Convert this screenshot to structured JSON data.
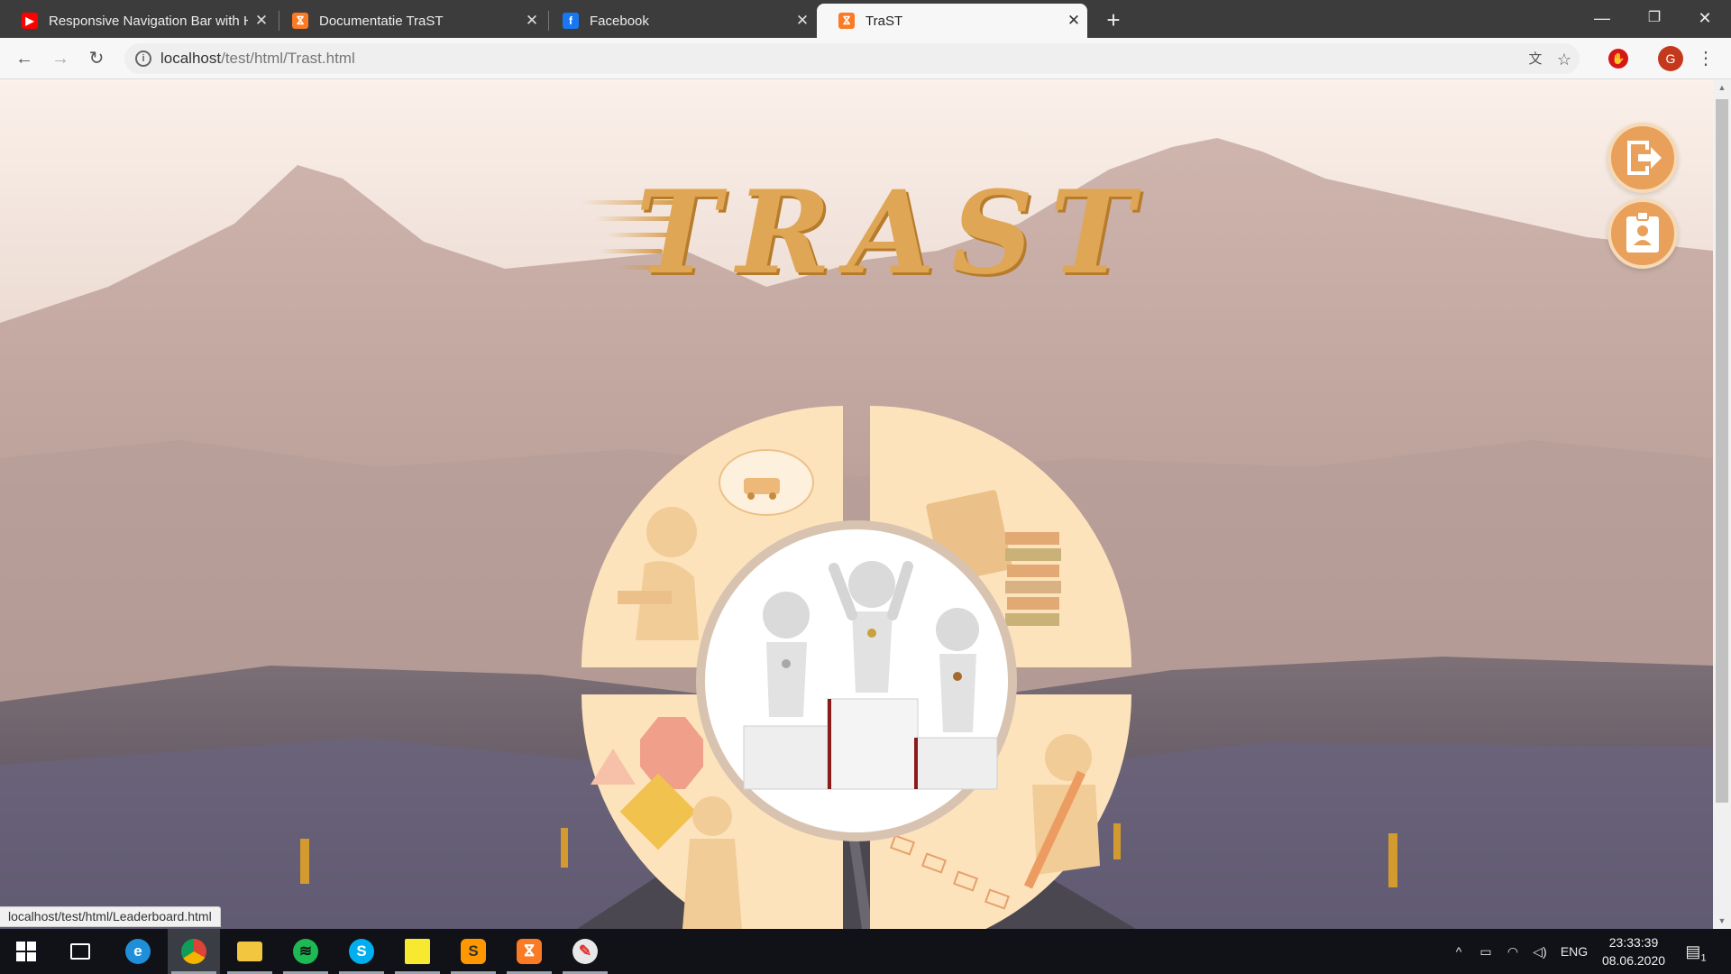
{
  "browser": {
    "tabs": [
      {
        "title": "Responsive Navigation Bar with H",
        "favicon": "youtube-icon",
        "color": "#ff0000",
        "active": false
      },
      {
        "title": "Documentatie TraST",
        "favicon": "xampp-icon",
        "color": "#fb7a24",
        "active": false
      },
      {
        "title": "Facebook",
        "favicon": "facebook-icon",
        "color": "#1877f2",
        "active": false
      },
      {
        "title": "TraST",
        "favicon": "xampp-icon",
        "color": "#fb7a24",
        "active": true
      }
    ],
    "url_host": "localhost",
    "url_path": "/test/html/Trast.html",
    "status_url": "localhost/test/html/Leaderboard.html",
    "profile_initial": "G"
  },
  "page": {
    "logo_text": "TRAST",
    "side_buttons": [
      "logout-icon",
      "profile-badge-icon"
    ],
    "center_image": "podium-winners",
    "quadrants": [
      "learning-thinker",
      "legislation-books",
      "road-signs",
      "test-checklist"
    ],
    "palette": {
      "accent": "#e8a05a",
      "quadrant": "#fde3bc",
      "logo": "#dfa656"
    }
  },
  "taskbar": {
    "apps": [
      "windows-start-icon",
      "task-view-icon",
      "edge-icon",
      "chrome-icon",
      "file-explorer-icon",
      "spotify-icon",
      "skype-icon",
      "sticky-notes-icon",
      "sublime-text-icon",
      "xampp-icon",
      "paint-icon"
    ],
    "language": "ENG",
    "time": "23:33:39",
    "date": "08.06.2020",
    "notification_count": "1"
  }
}
